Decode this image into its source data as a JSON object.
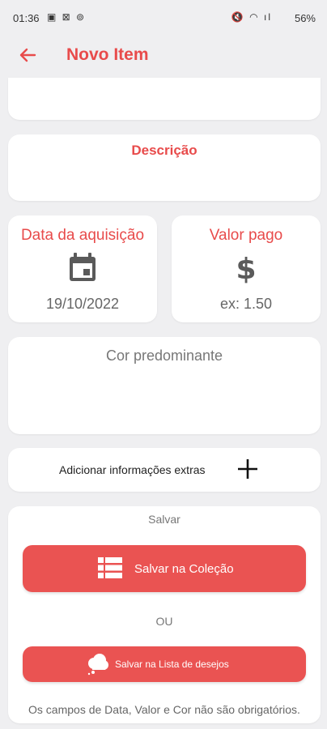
{
  "status_bar": {
    "time": "01:36",
    "left_icons": "▣ ⊠ ⊚",
    "right_icons": "🔇 ◠ ıl",
    "battery": "56%"
  },
  "app_bar": {
    "title": "Novo Item",
    "back_icon": "arrow-left-icon"
  },
  "form": {
    "description_label": "Descrição",
    "date_label": "Data da aquisição",
    "date_value": "19/10/2022",
    "date_icon": "calendar-icon",
    "value_label": "Valor pago",
    "value_placeholder": "ex: 1.50",
    "value_icon": "dollar-icon",
    "color_label": "Cor predominante",
    "extra_label": "Adicionar informações extras",
    "extra_icon": "plus-icon"
  },
  "save": {
    "title": "Salvar",
    "collection_button": "Salvar na Coleção",
    "collection_icon": "list-icon",
    "or_label": "OU",
    "wishlist_button": "Salvar na Lista de desejos",
    "wishlist_icon": "cloud-icon",
    "footnote": "Os campos de Data, Valor e Cor não são obrigatórios."
  },
  "colors": {
    "accent": "#e84b4b",
    "button": "#ea5352",
    "background": "#efeff1"
  }
}
